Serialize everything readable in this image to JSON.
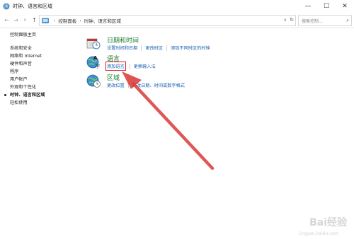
{
  "window": {
    "title": "时钟、语言和区域",
    "controls": {
      "minimize": "—",
      "maximize": "☐",
      "close": "✕"
    }
  },
  "addressbar": {
    "back": "←",
    "forward": "→",
    "recent": "∨",
    "up": "↑",
    "breadcrumbs": [
      "控制面板",
      "时钟、语言和区域"
    ],
    "separator": "›",
    "dropdown": "∨",
    "refresh": "↻",
    "search_placeholder": "搜索控制...",
    "search_icon": "search-icon"
  },
  "sidebar": {
    "home": "控制面板主页",
    "items": [
      {
        "label": "系统和安全",
        "active": false
      },
      {
        "label": "网络和 Internet",
        "active": false
      },
      {
        "label": "硬件和声音",
        "active": false
      },
      {
        "label": "程序",
        "active": false
      },
      {
        "label": "用户帐户",
        "active": false
      },
      {
        "label": "外观和个性化",
        "active": false
      },
      {
        "label": "时钟、语言和区域",
        "active": true
      },
      {
        "label": "轻松使用",
        "active": false
      }
    ]
  },
  "categories": [
    {
      "icon": "clock-icon",
      "title": "日期和时间",
      "links": [
        "设置时间和日期",
        "更改时区",
        "添加不同时区的时钟"
      ]
    },
    {
      "icon": "language-icon",
      "title": "语言",
      "links": [
        "添加语言",
        "更换输入法"
      ],
      "highlighted_link": "添加语言"
    },
    {
      "icon": "region-icon",
      "title": "区域",
      "links": [
        "更改位置",
        "更改日期、时间或数字格式"
      ]
    }
  ],
  "watermark": {
    "text": "Bai经验",
    "sub": "jingyan.baidu.com"
  },
  "colors": {
    "category_title": "#1a7c30",
    "link": "#1a5fb4",
    "highlight": "#d92020",
    "arrow": "#d9423f"
  }
}
